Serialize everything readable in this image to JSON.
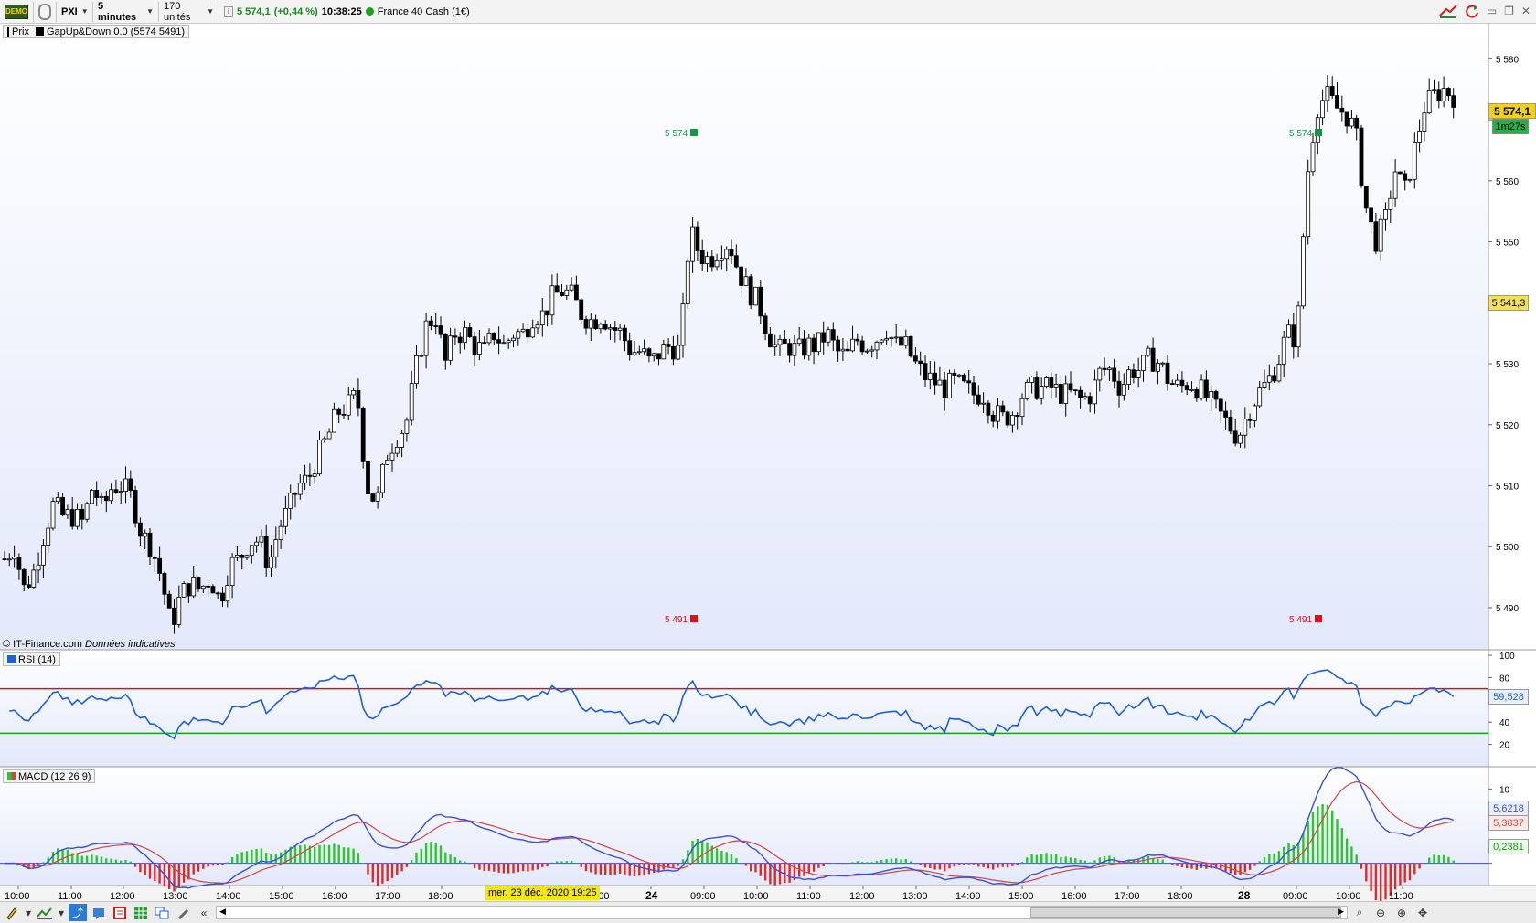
{
  "toolbar": {
    "demo_icon": "DEMO",
    "symbol": "PXI",
    "timeframe": "5 minutes",
    "units": "170 unités",
    "last_price": "5 574,1",
    "change": "(+0,44 %)",
    "time": "10:38:25",
    "instrument": "France 40 Cash (1€)"
  },
  "legends": {
    "price": "Prix",
    "indicator": "GapUp&Down 0.0 (5574 5491)",
    "rsi": "RSI (14)",
    "macd": "MACD (12 26 9)"
  },
  "copyright": {
    "source": "© IT-Finance.com",
    "note": "Données indicatives"
  },
  "price_tags": {
    "last": "5 574,1",
    "countdown": "1m27s",
    "gap_level": "5 541,3",
    "rsi_value": "59,528",
    "macd_value": "5,6218",
    "macd_signal": "5,3837",
    "macd_hist": "0,2381"
  },
  "gap_labels": {
    "up_1": "5 574",
    "down_1": "5 491",
    "up_2": "5 574",
    "down_2": "5 491"
  },
  "colors": {
    "up": "#ffffff",
    "down": "#000000",
    "rsi_line": "#1f5fd6",
    "rsi_upper": "#e01010",
    "rsi_lower": "#16a016",
    "macd_line": "#3b4fd6",
    "signal_line": "#d04545",
    "hist_pos": "#2bc62b",
    "hist_neg": "#e02828",
    "gap_up": "#119a3a",
    "gap_down": "#e01010",
    "last_price_bg": "#f3d11a"
  },
  "date_tooltip": "mer. 23 déc. 2020 19:25",
  "chart_data": [
    {
      "type": "candlestick",
      "title": "PXI",
      "yticks": [
        "5 490",
        "5 500",
        "5 510",
        "5 520",
        "5 530",
        "5 540",
        "5 550",
        "5 560",
        "5 570",
        "5 580"
      ],
      "ylim": [
        5484,
        5585
      ],
      "xticks": [
        "10:00",
        "11:00",
        "12:00",
        "13:00",
        "14:00",
        "15:00",
        "16:00",
        "17:00",
        "18:00",
        "19:25",
        "21:00",
        "24",
        "09:00",
        "10:00",
        "11:00",
        "12:00",
        "13:00",
        "14:00",
        "15:00",
        "16:00",
        "17:00",
        "18:00",
        "28",
        "09:00",
        "10:00",
        "11:00"
      ],
      "close_path": [
        [
          0,
          5498
        ],
        [
          10,
          5500
        ],
        [
          20,
          5493
        ],
        [
          30,
          5496
        ],
        [
          40,
          5502
        ],
        [
          50,
          5507
        ],
        [
          60,
          5505
        ],
        [
          70,
          5505
        ],
        [
          80,
          5504
        ],
        [
          90,
          5510
        ],
        [
          100,
          5506
        ],
        [
          110,
          5510
        ],
        [
          120,
          5510
        ],
        [
          130,
          5508
        ],
        [
          140,
          5502
        ],
        [
          150,
          5500
        ],
        [
          160,
          5495
        ],
        [
          170,
          5487
        ],
        [
          180,
          5492
        ],
        [
          190,
          5494
        ],
        [
          200,
          5493
        ],
        [
          210,
          5495
        ],
        [
          220,
          5491
        ],
        [
          230,
          5497
        ],
        [
          240,
          5498
        ],
        [
          250,
          5501
        ],
        [
          260,
          5501
        ],
        [
          270,
          5497
        ],
        [
          280,
          5503
        ],
        [
          290,
          5506
        ],
        [
          300,
          5510
        ],
        [
          310,
          5511
        ],
        [
          320,
          5515
        ],
        [
          330,
          5518
        ],
        [
          340,
          5522
        ],
        [
          350,
          5523
        ],
        [
          360,
          5525
        ],
        [
          370,
          5510
        ],
        [
          380,
          5507
        ],
        [
          390,
          5515
        ],
        [
          400,
          5518
        ],
        [
          410,
          5520
        ],
        [
          420,
          5529
        ],
        [
          430,
          5536
        ],
        [
          440,
          5538
        ],
        [
          450,
          5530
        ],
        [
          460,
          5535
        ],
        [
          470,
          5535
        ],
        [
          480,
          5533
        ],
        [
          490,
          5532
        ],
        [
          500,
          5535
        ],
        [
          510,
          5533
        ],
        [
          520,
          5535
        ],
        [
          530,
          5535
        ],
        [
          540,
          5538
        ],
        [
          550,
          5538
        ],
        [
          560,
          5541
        ],
        [
          570,
          5542
        ],
        [
          580,
          5541
        ],
        [
          590,
          5538
        ],
        [
          600,
          5537
        ],
        [
          610,
          5538
        ],
        [
          620,
          5536
        ],
        [
          630,
          5535
        ],
        [
          640,
          5532
        ],
        [
          650,
          5532
        ],
        [
          660,
          5530
        ],
        [
          670,
          5532
        ],
        [
          680,
          5533
        ],
        [
          690,
          5532
        ],
        [
          700,
          5552
        ],
        [
          710,
          5548
        ],
        [
          720,
          5547
        ],
        [
          730,
          5549
        ],
        [
          740,
          5550
        ],
        [
          750,
          5545
        ],
        [
          760,
          5542
        ],
        [
          770,
          5540
        ],
        [
          780,
          5535
        ],
        [
          790,
          5532
        ],
        [
          800,
          5533
        ],
        [
          810,
          5532
        ],
        [
          820,
          5533
        ],
        [
          830,
          5533
        ],
        [
          840,
          5535
        ],
        [
          850,
          5532
        ],
        [
          860,
          5531
        ],
        [
          870,
          5534
        ],
        [
          880,
          5533
        ],
        [
          890,
          5534
        ],
        [
          900,
          5536
        ],
        [
          910,
          5533
        ],
        [
          920,
          5533
        ],
        [
          930,
          5530
        ],
        [
          940,
          5528
        ],
        [
          950,
          5527
        ],
        [
          960,
          5526
        ],
        [
          970,
          5527
        ],
        [
          980,
          5526
        ],
        [
          990,
          5525
        ],
        [
          1000,
          5525
        ],
        [
          1010,
          5522
        ],
        [
          1020,
          5521
        ],
        [
          1030,
          5522
        ],
        [
          1040,
          5525
        ],
        [
          1050,
          5526
        ],
        [
          1060,
          5526
        ],
        [
          1070,
          5526
        ],
        [
          1080,
          5525
        ],
        [
          1090,
          5525
        ],
        [
          1100,
          5524
        ],
        [
          1110,
          5525
        ],
        [
          1120,
          5529
        ],
        [
          1130,
          5529
        ],
        [
          1140,
          5526
        ],
        [
          1150,
          5529
        ],
        [
          1160,
          5529
        ],
        [
          1170,
          5531
        ],
        [
          1180,
          5530
        ],
        [
          1190,
          5527
        ],
        [
          1200,
          5526
        ],
        [
          1210,
          5527
        ],
        [
          1220,
          5526
        ],
        [
          1230,
          5524
        ],
        [
          1240,
          5522
        ],
        [
          1250,
          5520
        ],
        [
          1260,
          5518
        ],
        [
          1270,
          5522
        ],
        [
          1280,
          5525
        ],
        [
          1290,
          5527
        ],
        [
          1300,
          5530
        ],
        [
          1310,
          5535
        ],
        [
          1320,
          5534
        ],
        [
          1330,
          5560
        ],
        [
          1340,
          5572
        ],
        [
          1350,
          5574
        ],
        [
          1360,
          5572
        ],
        [
          1370,
          5571
        ],
        [
          1380,
          5568
        ],
        [
          1390,
          5556
        ],
        [
          1400,
          5550
        ],
        [
          1410,
          5553
        ],
        [
          1420,
          5562
        ],
        [
          1430,
          5558
        ],
        [
          1440,
          5565
        ],
        [
          1450,
          5572
        ],
        [
          1460,
          5574
        ],
        [
          1470,
          5575
        ],
        [
          1480,
          5574
        ]
      ]
    },
    {
      "type": "line",
      "title": "RSI (14)",
      "yticks": [
        "20",
        "40",
        "60",
        "80",
        "100"
      ],
      "levels": [
        70,
        30
      ],
      "ylim": [
        0,
        105
      ]
    },
    {
      "type": "line+bar",
      "title": "MACD (12 26 9)",
      "yticks": [
        "0",
        "10"
      ],
      "ylim": [
        -3,
        13
      ]
    }
  ]
}
